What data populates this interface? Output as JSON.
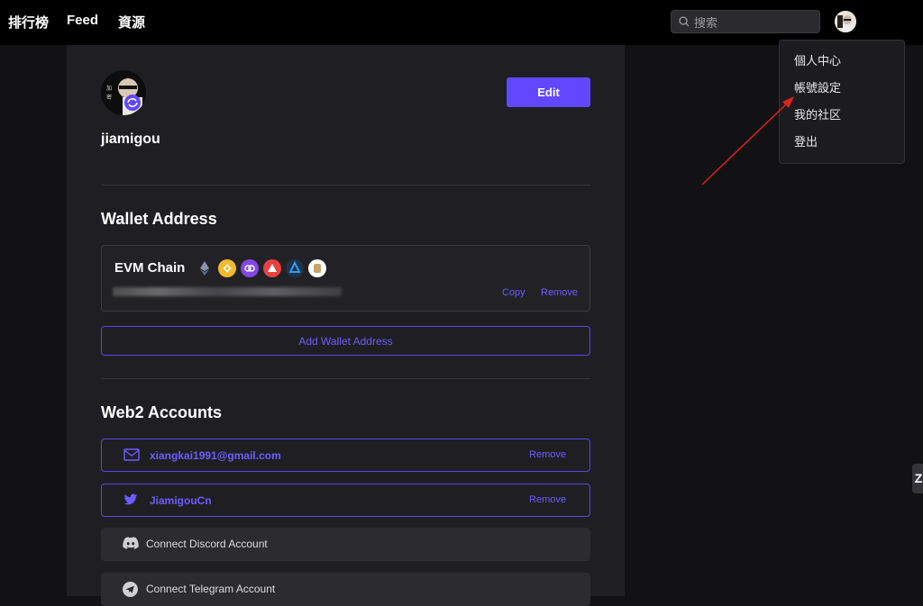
{
  "nav": {
    "items": [
      "排行榜",
      "Feed",
      "資源"
    ]
  },
  "search": {
    "placeholder": "搜索",
    "icon": "search-icon"
  },
  "user_menu": {
    "items": [
      "個人中心",
      "帳號設定",
      "我的社区",
      "登出"
    ],
    "highlighted": "帳號設定"
  },
  "profile": {
    "username": "jiamigou",
    "edit_label": "Edit"
  },
  "wallet": {
    "title": "Wallet Address",
    "chain_name": "EVM Chain",
    "chain_icons": [
      "ethereum-icon",
      "bnb-icon",
      "polygon-icon",
      "avalanche-icon",
      "arbitrum-icon",
      "scroll-icon"
    ],
    "copy_label": "Copy",
    "remove_label": "Remove",
    "add_label": "Add Wallet Address"
  },
  "web2": {
    "title": "Web2 Accounts",
    "accounts": [
      {
        "icon": "email-icon",
        "value": "xiangkai1991@gmail.com",
        "remove_label": "Remove"
      },
      {
        "icon": "twitter-icon",
        "value": "JiamigouCn",
        "remove_label": "Remove"
      }
    ],
    "connect": [
      {
        "icon": "discord-icon",
        "label": "Connect Discord Account"
      },
      {
        "icon": "telegram-icon",
        "label": "Connect Telegram Account"
      }
    ]
  },
  "side_tab": {
    "label": "Z"
  },
  "colors": {
    "accent": "#6148ff",
    "accent_text": "#6e5cff",
    "background": "#121214",
    "panel": "#1f1f23",
    "annotation_arrow": "#e02020"
  }
}
